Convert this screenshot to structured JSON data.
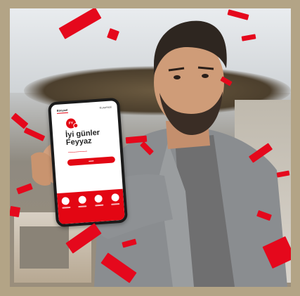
{
  "phone": {
    "tabs": [
      "Bireysel",
      "Kurumsal"
    ],
    "avatar_initials": "FY",
    "greeting_line1": "İyi günler",
    "greeting_line2": "Feyyaz",
    "icons": [
      "qr-icon",
      "transfer-icon",
      "payment-icon",
      "card-icon",
      "menu-icon"
    ]
  },
  "colors": {
    "brand_red": "#e30613",
    "frame_border": "#b3a486"
  }
}
